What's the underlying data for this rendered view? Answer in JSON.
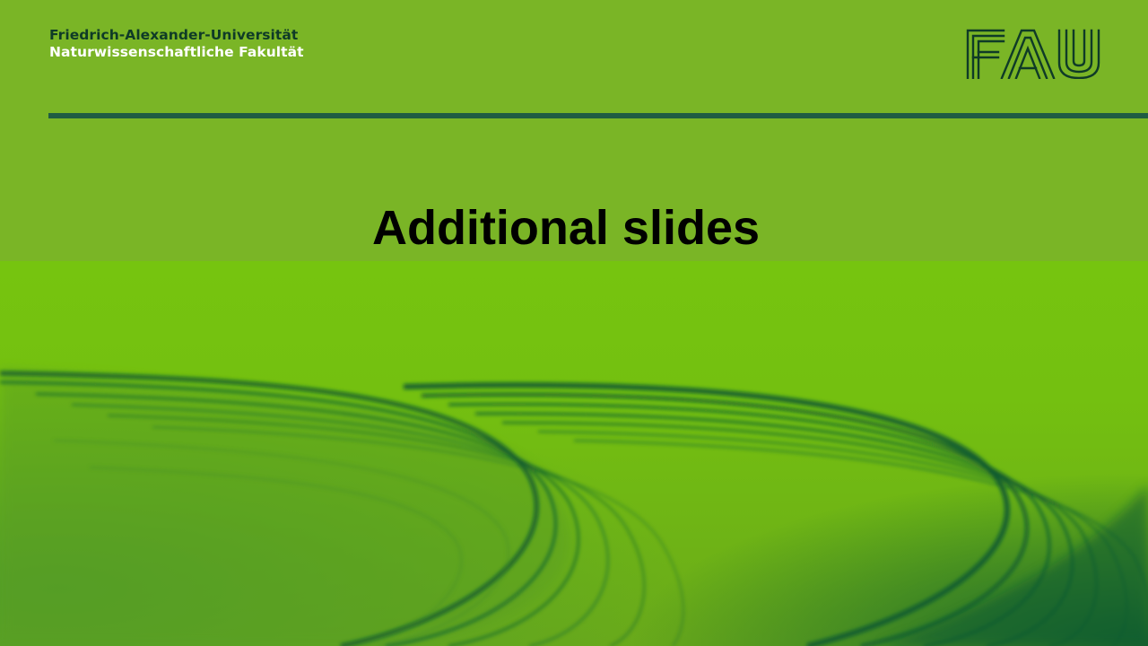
{
  "header": {
    "institution_line1": "Friedrich-Alexander-Universität",
    "institution_line2": "Naturwissenschaftliche Fakultät",
    "logo_text": "FAU"
  },
  "slide": {
    "title": "Additional slides"
  },
  "colors": {
    "background": "#7ab526",
    "image_green": "#76c40f",
    "dark_green": "#0a5a30",
    "rule": "#1f5c43",
    "institution_text": "#0f3b27"
  },
  "background_image": {
    "icon": "green-swirl-waves"
  }
}
